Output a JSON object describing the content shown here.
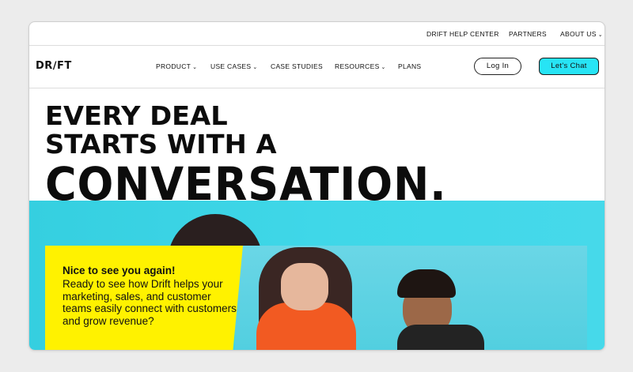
{
  "util_nav": {
    "help_center": "DRIFT HELP CENTER",
    "partners": "PARTNERS",
    "about_us": "ABOUT US"
  },
  "header": {
    "logo": "DR∕FT",
    "nav": {
      "product": "PRODUCT",
      "use_cases": "USE CASES",
      "case_studies": "CASE STUDIES",
      "resources": "RESOURCES",
      "plans": "PLANS"
    },
    "login_label": "Log In",
    "chat_label": "Let's Chat"
  },
  "hero": {
    "line1": "EVERY DEAL",
    "line2": "STARTS WITH A",
    "line3": "CONVERSATION."
  },
  "card": {
    "title": "Nice to see you again!",
    "body": "Ready to see how Drift helps your marketing, sales, and customer teams easily connect with customers and grow revenue?"
  },
  "colors": {
    "accent_cyan": "#27e4f5",
    "card_yellow": "#fff200"
  }
}
